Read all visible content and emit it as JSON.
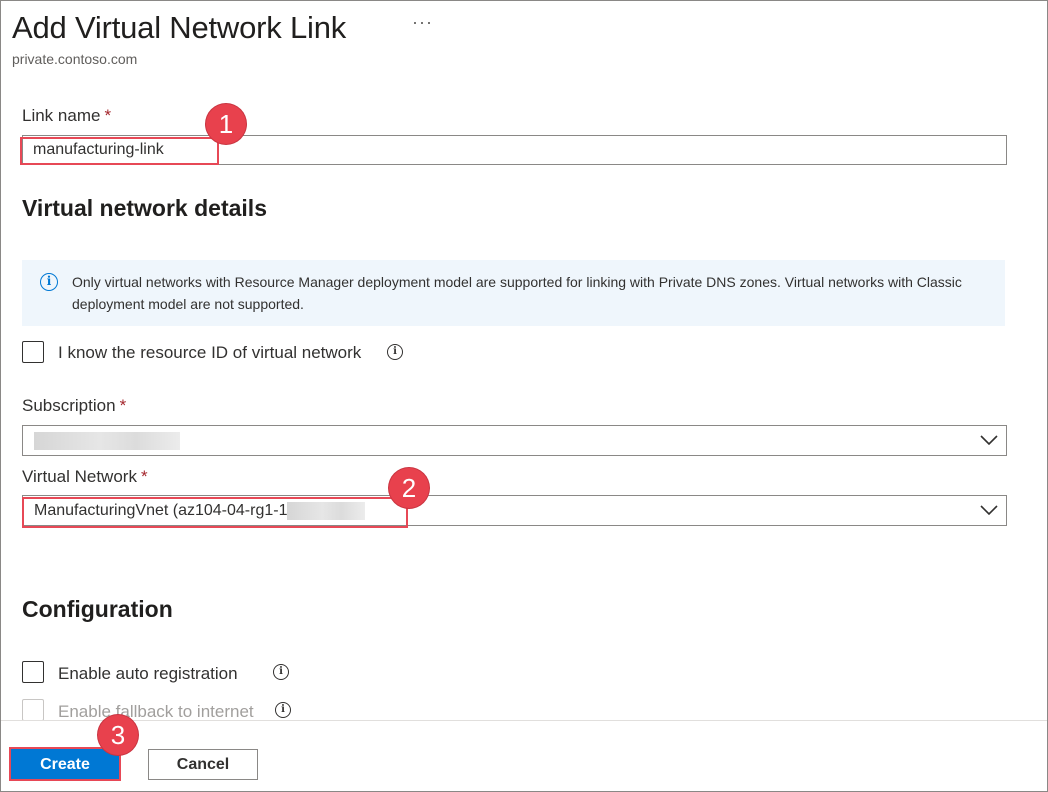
{
  "header": {
    "title": "Add Virtual Network Link",
    "more_label": "···",
    "subtitle": "private.contoso.com"
  },
  "link_name": {
    "label": "Link name",
    "required": "*",
    "value": "manufacturing-link"
  },
  "virtual_network_details": {
    "heading": "Virtual network details",
    "info_message": "Only virtual networks with Resource Manager deployment model are supported for linking with Private DNS zones. Virtual networks with Classic deployment model are not supported.",
    "resource_id_checkbox_label": "I know the resource ID of virtual network",
    "resource_id_checked": false
  },
  "subscription": {
    "label": "Subscription",
    "required": "*",
    "value": ""
  },
  "virtual_network": {
    "label": "Virtual Network",
    "required": "*",
    "value": "ManufacturingVnet (az104-04-rg1-1"
  },
  "configuration": {
    "heading": "Configuration",
    "auto_registration_label": "Enable auto registration",
    "auto_registration_checked": false,
    "fallback_label": "Enable fallback to internet",
    "fallback_checked": false
  },
  "footer": {
    "create_label": "Create",
    "cancel_label": "Cancel"
  },
  "annotations": {
    "badge_1": "1",
    "badge_2": "2",
    "badge_3": "3"
  },
  "colors": {
    "accent": "#0078d4",
    "required": "#a4262c",
    "annotation_red": "#e8414d",
    "info_background": "#eff6fc"
  },
  "icons": {
    "more": "ellipsis-icon",
    "info": "info-icon",
    "dropdown": "chevron-down-icon"
  }
}
